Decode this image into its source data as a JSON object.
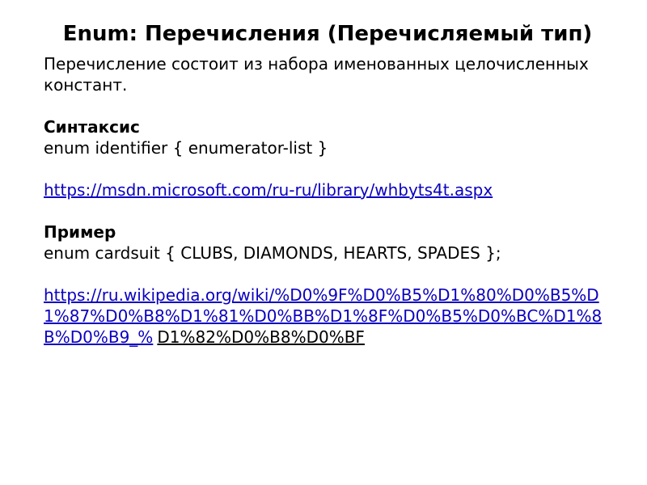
{
  "slide": {
    "title": "Enum: Перечисления (Перечисляемый тип)",
    "intro": "Перечисление состоит из набора именованных целочисленных констант.",
    "syntax_head": "Синтаксис",
    "syntax_code": "enum identifier { enumerator-list }",
    "link_msdn": "https://msdn.microsoft.com/ru-ru/library/whbyts4t.aspx",
    "example_head": "Пример",
    "example_code": "enum cardsuit { CLUBS, DIAMONDS, HEARTS, SPADES };",
    "link_wiki_blue": "https://ru.wikipedia.org/wiki/%D0%9F%D0%B5%D1%80%D0%B5%D1%87%D0%B8%D1%81%D0%BB%D1%8F%D0%B5%D0%BC%D1%8B%D0%B9_%",
    "link_wiki_tail": "D1%82%D0%B8%D0%BF"
  }
}
